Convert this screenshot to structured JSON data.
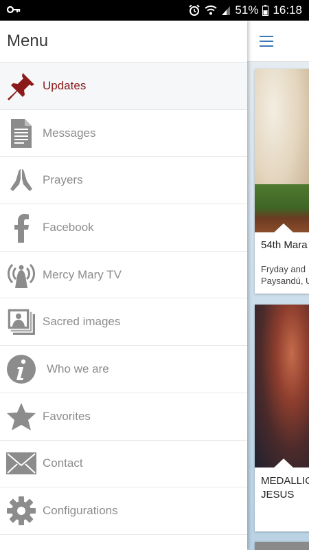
{
  "status": {
    "time": "16:18",
    "battery": "51%",
    "icons": [
      "key-icon",
      "alarm-icon",
      "wifi-icon",
      "signal-icon",
      "battery-icon"
    ]
  },
  "drawer": {
    "title": "Menu",
    "items": [
      {
        "label": "Updates",
        "icon": "pushpin-icon",
        "active": true
      },
      {
        "label": "Messages",
        "icon": "document-icon"
      },
      {
        "label": "Prayers",
        "icon": "praying-hands-icon"
      },
      {
        "label": "Facebook",
        "icon": "facebook-icon"
      },
      {
        "label": "Mercy Mary TV",
        "icon": "broadcast-icon"
      },
      {
        "label": "Sacred images",
        "icon": "photos-icon"
      },
      {
        "label": "Who we are",
        "icon": "info-icon"
      },
      {
        "label": "Favorites",
        "icon": "star-icon"
      },
      {
        "label": "Contact",
        "icon": "envelope-icon"
      },
      {
        "label": "Configurations",
        "icon": "gear-icon"
      }
    ]
  },
  "feed": {
    "cards": [
      {
        "title": "54th Mara",
        "subtitle_lines": [
          "Fryday and",
          "Paysandú, U"
        ]
      },
      {
        "title_lines": [
          "MEDALLIO",
          "JESUS"
        ]
      }
    ]
  },
  "colors": {
    "active": "#8b1a1a",
    "icon_gray": "#8c8c8c",
    "accent": "#3a78b8"
  }
}
